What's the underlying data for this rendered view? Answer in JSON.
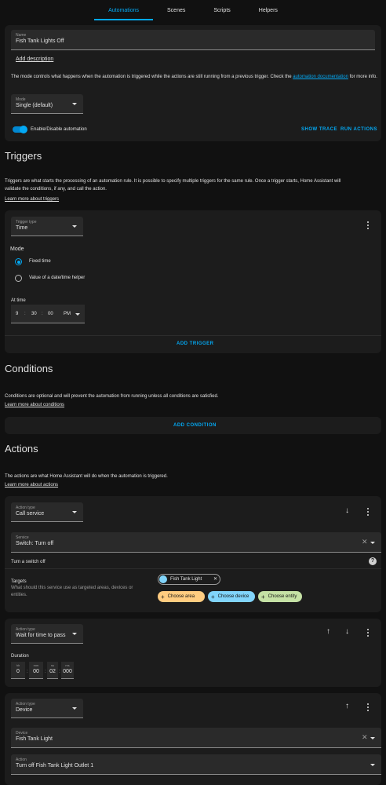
{
  "nav": {
    "tabs": [
      "Automations",
      "Scenes",
      "Scripts",
      "Helpers"
    ]
  },
  "details": {
    "name_label": "Name",
    "name_value": "Fish Tank Lights Off",
    "add_description": "Add description",
    "mode_text_1": "The mode controls what happens when the automation is triggered while the actions are still running from a previous trigger. Check the",
    "mode_link": "automation documentation",
    "mode_text_2": "for more info.",
    "mode_label": "Mode",
    "mode_value": "Single (default)",
    "enable_label": "Enable/Disable automation",
    "show_trace": "SHOW TRACE",
    "run_actions": "RUN ACTIONS",
    "enabled": true
  },
  "triggers": {
    "heading": "Triggers",
    "desc_1": "Triggers are what starts the processing of an automation rule. It is possible to specify multiple triggers for the same rule. Once a trigger starts, Home Assistant will",
    "desc_2": "validate the conditions, if any, and call the action.",
    "learn_more": "Learn more about triggers",
    "type_label": "Trigger type",
    "type_value": "Time",
    "mode_heading": "Mode",
    "option_fixed": "Fixed time",
    "option_helper": "Value of a date/time helper",
    "selected_option": "Fixed time",
    "at_time_label": "At time",
    "hour": "9",
    "minute": "30",
    "second": "00",
    "ampm": "PM",
    "add_trigger": "ADD TRIGGER"
  },
  "conditions": {
    "heading": "Conditions",
    "desc": "Conditions are optional and will prevent the automation from running unless all conditions are satisfied.",
    "learn_more": "Learn more about conditions",
    "add_condition": "ADD CONDITION"
  },
  "actions": {
    "heading": "Actions",
    "desc": "The actions are what Home Assistant will do when the automation is triggered.",
    "learn_more": "Learn more about actions",
    "action1": {
      "type_label": "Action type",
      "type_value": "Call service",
      "service_label": "Service",
      "service_value": "Switch: Turn off",
      "service_desc": "Turn a switch off",
      "targets_label": "Targets",
      "targets_desc_1": "What should this service use as targeted areas, devices or",
      "targets_desc_2": "entities.",
      "target_chip": "Fish Tank Light",
      "choose_area": "Choose area",
      "choose_device": "Choose device",
      "choose_entity": "Choose entity"
    },
    "action2": {
      "type_label": "Action type",
      "type_value": "Wait for time to pass",
      "duration_label": "Duration",
      "hh_label": "hh",
      "mm_label": "mm",
      "ss_label": "ss",
      "ms_label": "ms",
      "hh": "0",
      "mm": "00",
      "ss": "02",
      "ms": "000"
    },
    "action3": {
      "type_label": "Action type",
      "type_value": "Device",
      "device_label": "Device",
      "device_value": "Fish Tank Light",
      "action_label": "Action",
      "action_value": "Turn off Fish Tank Light Outlet 1"
    }
  },
  "colors": {
    "accent": "#03a9f4",
    "card": "#1c1c1c",
    "background": "#111111",
    "area_chip": "#ffcc80",
    "device_chip": "#81d4fa",
    "entity_chip": "#c5e1a5"
  },
  "icons": [
    "dots-vertical-icon",
    "arrow-up-icon",
    "arrow-down-icon",
    "close-icon",
    "help-circle-icon",
    "device-icon",
    "plus-icon"
  ]
}
